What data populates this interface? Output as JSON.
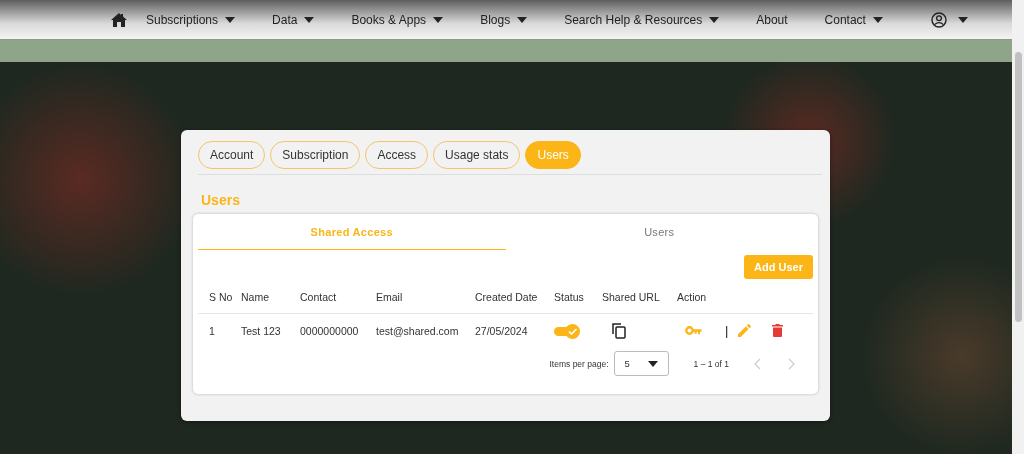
{
  "nav": {
    "items": [
      {
        "label": "Subscriptions",
        "dropdown": true
      },
      {
        "label": "Data",
        "dropdown": true
      },
      {
        "label": "Books & Apps",
        "dropdown": true
      },
      {
        "label": "Blogs",
        "dropdown": true
      },
      {
        "label": "Search Help & Resources",
        "dropdown": true
      },
      {
        "label": "About",
        "dropdown": false
      },
      {
        "label": "Contact",
        "dropdown": true
      }
    ]
  },
  "tabs": [
    {
      "label": "Account",
      "selected": false
    },
    {
      "label": "Subscription",
      "selected": false
    },
    {
      "label": "Access",
      "selected": false
    },
    {
      "label": "Usage stats",
      "selected": false
    },
    {
      "label": "Users",
      "selected": true
    }
  ],
  "section_title": "Users",
  "subtabs": [
    {
      "label": "Shared Access",
      "selected": true
    },
    {
      "label": "Users",
      "selected": false
    }
  ],
  "add_button": "Add User",
  "table": {
    "columns": [
      "S No",
      "Name",
      "Contact",
      "Email",
      "Created Date",
      "Status",
      "Shared URL",
      "Action"
    ],
    "rows": [
      {
        "cells": [
          "1",
          "Test 123",
          "0000000000",
          "test@shared.com",
          "27/05/2024"
        ],
        "status_on": true,
        "action_separator": "|"
      }
    ]
  },
  "paginator": {
    "items_label": "Items per page:",
    "page_size": "5",
    "range": "1 – 1 of 1",
    "prev_disabled": true,
    "next_disabled": true
  }
}
